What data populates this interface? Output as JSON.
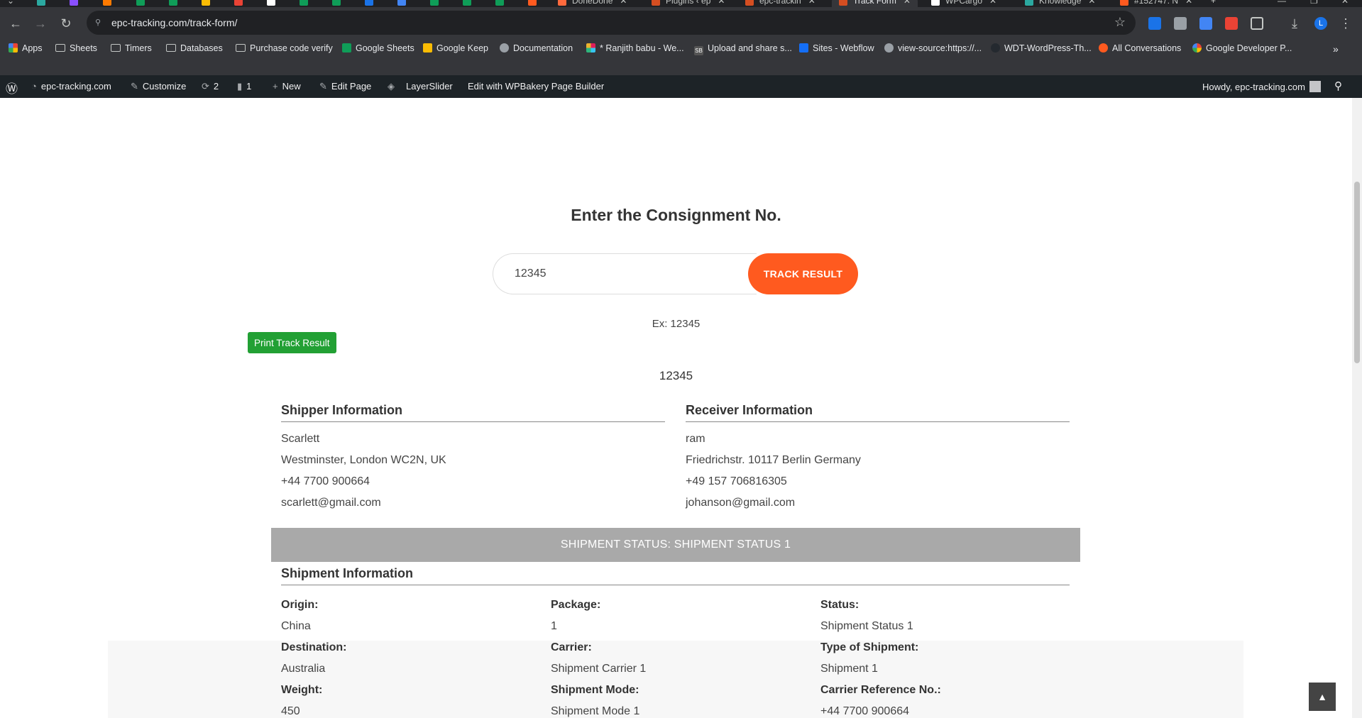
{
  "browser": {
    "tabs": [
      {
        "title": "DoneDone",
        "color": "#ff6a3d"
      },
      {
        "title": "Plugins ‹ ep",
        "color": "#d54e21"
      },
      {
        "title": "epc-trackin",
        "color": "#d54e21"
      },
      {
        "title": "Track Form",
        "color": "#d54e21"
      },
      {
        "title": "WPCargo",
        "color": "#ffffff"
      },
      {
        "title": "Knowledge",
        "color": "#2ba8a0"
      },
      {
        "title": "#152747: N",
        "color": "#ff5a1f"
      }
    ],
    "url": "epc-tracking.com/track-form/",
    "bookmarks": [
      {
        "label": "Apps",
        "icon": "apps-grid-icon"
      },
      {
        "label": "Sheets",
        "icon": "folder-icon"
      },
      {
        "label": "Timers",
        "icon": "folder-icon"
      },
      {
        "label": "Databases",
        "icon": "folder-icon"
      },
      {
        "label": "Purchase code verify",
        "icon": "folder-icon"
      },
      {
        "label": "Google Sheets",
        "icon": "google-sheets-icon"
      },
      {
        "label": "Google Keep",
        "icon": "google-keep-icon"
      },
      {
        "label": "Documentation",
        "icon": "globe-icon"
      },
      {
        "label": "* Ranjith babu - We...",
        "icon": "slack-icon"
      },
      {
        "label": "Upload and share s...",
        "icon": "sb-icon"
      },
      {
        "label": "Sites - Webflow",
        "icon": "webflow-icon"
      },
      {
        "label": "view-source:https://...",
        "icon": "globe-icon"
      },
      {
        "label": "WDT-WordPress-Th...",
        "icon": "github-icon"
      },
      {
        "label": "All Conversations",
        "icon": "conversations-icon"
      },
      {
        "label": "Google Developer P...",
        "icon": "google-icon"
      }
    ]
  },
  "adminbar": {
    "site": "epc-tracking.com",
    "customize": "Customize",
    "updates": "2",
    "comments": "1",
    "new": "New",
    "edit_page": "Edit Page",
    "layerslider": "LayerSlider",
    "wpbakery": "Edit with WPBakery Page Builder",
    "howdy": "Howdy, epc-tracking.com"
  },
  "form": {
    "title": "Enter the Consignment No.",
    "input_value": "12345",
    "button_label": "TRACK RESULT",
    "example": "Ex: 12345",
    "print_label": "Print Track Result"
  },
  "result": {
    "tracking_number": "12345",
    "shipper": {
      "heading": "Shipper Information",
      "name": "Scarlett",
      "address": "Westminster, London WC2N, UK",
      "phone": "+44 7700 900664",
      "email": "scarlett@gmail.com"
    },
    "receiver": {
      "heading": "Receiver Information",
      "name": "ram",
      "address": "Friedrichstr. 10117 Berlin Germany",
      "phone": "+49 157 706816305",
      "email": "johanson@gmail.com"
    },
    "status_bar": "SHIPMENT STATUS: SHIPMENT STATUS 1",
    "shipment_heading": "Shipment Information",
    "fields": {
      "origin_label": "Origin:",
      "origin": "China",
      "package_label": "Package:",
      "package": "1",
      "status_label": "Status:",
      "status": "Shipment Status 1",
      "destination_label": "Destination:",
      "destination": "Australia",
      "carrier_label": "Carrier:",
      "carrier": "Shipment Carrier 1",
      "type_label": "Type of Shipment:",
      "type": "Shipment 1",
      "weight_label": "Weight:",
      "weight": "450",
      "mode_label": "Shipment Mode:",
      "mode": "Shipment Mode 1",
      "carrier_ref_label": "Carrier Reference No.:",
      "carrier_ref": "+44 7700 900664"
    }
  }
}
